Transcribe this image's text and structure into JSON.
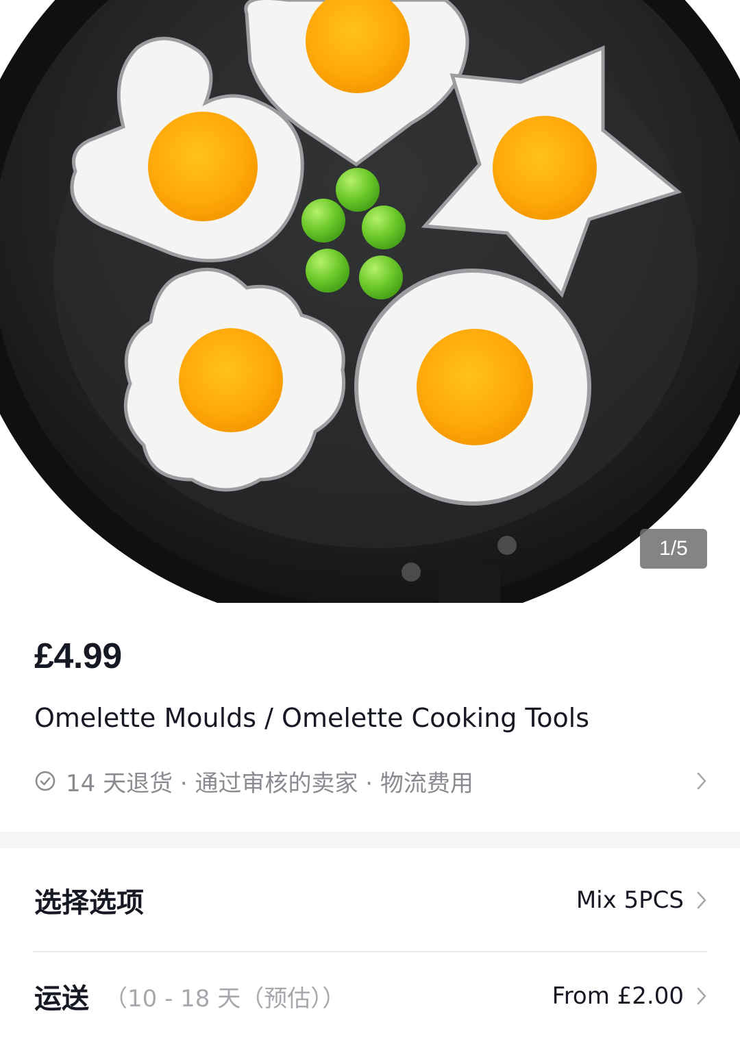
{
  "gallery": {
    "counter": "1/5",
    "image_alt": "egg-moulds-in-pan"
  },
  "product": {
    "price": "£4.99",
    "title": "Omelette Moulds / Omelette Cooking Tools",
    "policy": "14 天退货 · 通过审核的卖家 · 物流费用"
  },
  "options": {
    "label": "选择选项",
    "value": "Mix 5PCS"
  },
  "shipping": {
    "label": "运送",
    "eta": "（10 - 18 天（预估））",
    "value": "From £2.00"
  },
  "colors": {
    "text": "#161823",
    "muted": "#8a8b91",
    "divider": "#f5f5f6"
  }
}
